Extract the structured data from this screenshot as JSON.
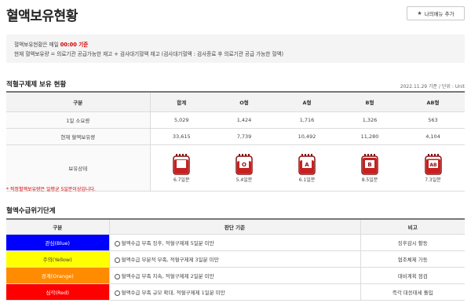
{
  "header": {
    "title": "혈액보유현황",
    "fav_button": "나의메뉴 추가"
  },
  "info": {
    "line1_prefix": "혈액보유현황은 매일 ",
    "line1_time": "00:00 기준",
    "line2": "현재 혈액보유량 = 의료기관 공급가능한 재고 + 검사대기혈액 재고 (검사대기혈액 : 검사종료 후 의료기관 공급 가능한 혈액)"
  },
  "stock": {
    "title": "적혈구제제 보유 현황",
    "meta": "2022.11.29 기준 / 단위 : Unit",
    "headers": [
      "구분",
      "합계",
      "O형",
      "A형",
      "B형",
      "AB형"
    ],
    "rows": [
      {
        "label": "1일 소요량",
        "values": [
          "5,029",
          "1,424",
          "1,716",
          "1,326",
          "563"
        ]
      },
      {
        "label": "현재 혈액보유량",
        "values": [
          "33,615",
          "7,739",
          "10,492",
          "11,280",
          "4,104"
        ]
      }
    ],
    "status_label": "보유상태",
    "bags": [
      {
        "type": "",
        "days": "6.7일분",
        "fill": 0.85
      },
      {
        "type": "O",
        "days": "5.4일분",
        "fill": 0.75
      },
      {
        "type": "A",
        "days": "6.1일분",
        "fill": 0.8
      },
      {
        "type": "B",
        "days": "8.5일분",
        "fill": 0.95
      },
      {
        "type": "AB",
        "days": "7.3일분",
        "fill": 0.88
      }
    ],
    "note": "* 적정혈액보유량은 일평균 5일분이상입니다."
  },
  "crisis": {
    "title": "혈액수급위기단계",
    "headers": [
      "구분",
      "판단 기준",
      "비고"
    ],
    "levels": [
      {
        "name": "관심(Blue)",
        "color": "#0000ff",
        "criteria": "혈액수급 부족 징후, 적혈구제제 5일분 미만",
        "note": "징후감시 활동"
      },
      {
        "name": "주의(Yellow)",
        "color": "#ffff00",
        "criteria": "혈액수급 부분적 부족, 적혈구제제 3일분 미만",
        "note": "협조체제 가동"
      },
      {
        "name": "경계(Orange)",
        "color": "#ff8c00",
        "criteria": "혈액수급 부족 지속, 적혈구제제 2일분 미만",
        "note": "대비계획 점검"
      },
      {
        "name": "심각(Red)",
        "color": "#ff0000",
        "criteria": "혈액수급 부족 규모 확대, 적혈구제제 1일분 미만",
        "note": "즉각 대응태세 돌입"
      }
    ]
  }
}
